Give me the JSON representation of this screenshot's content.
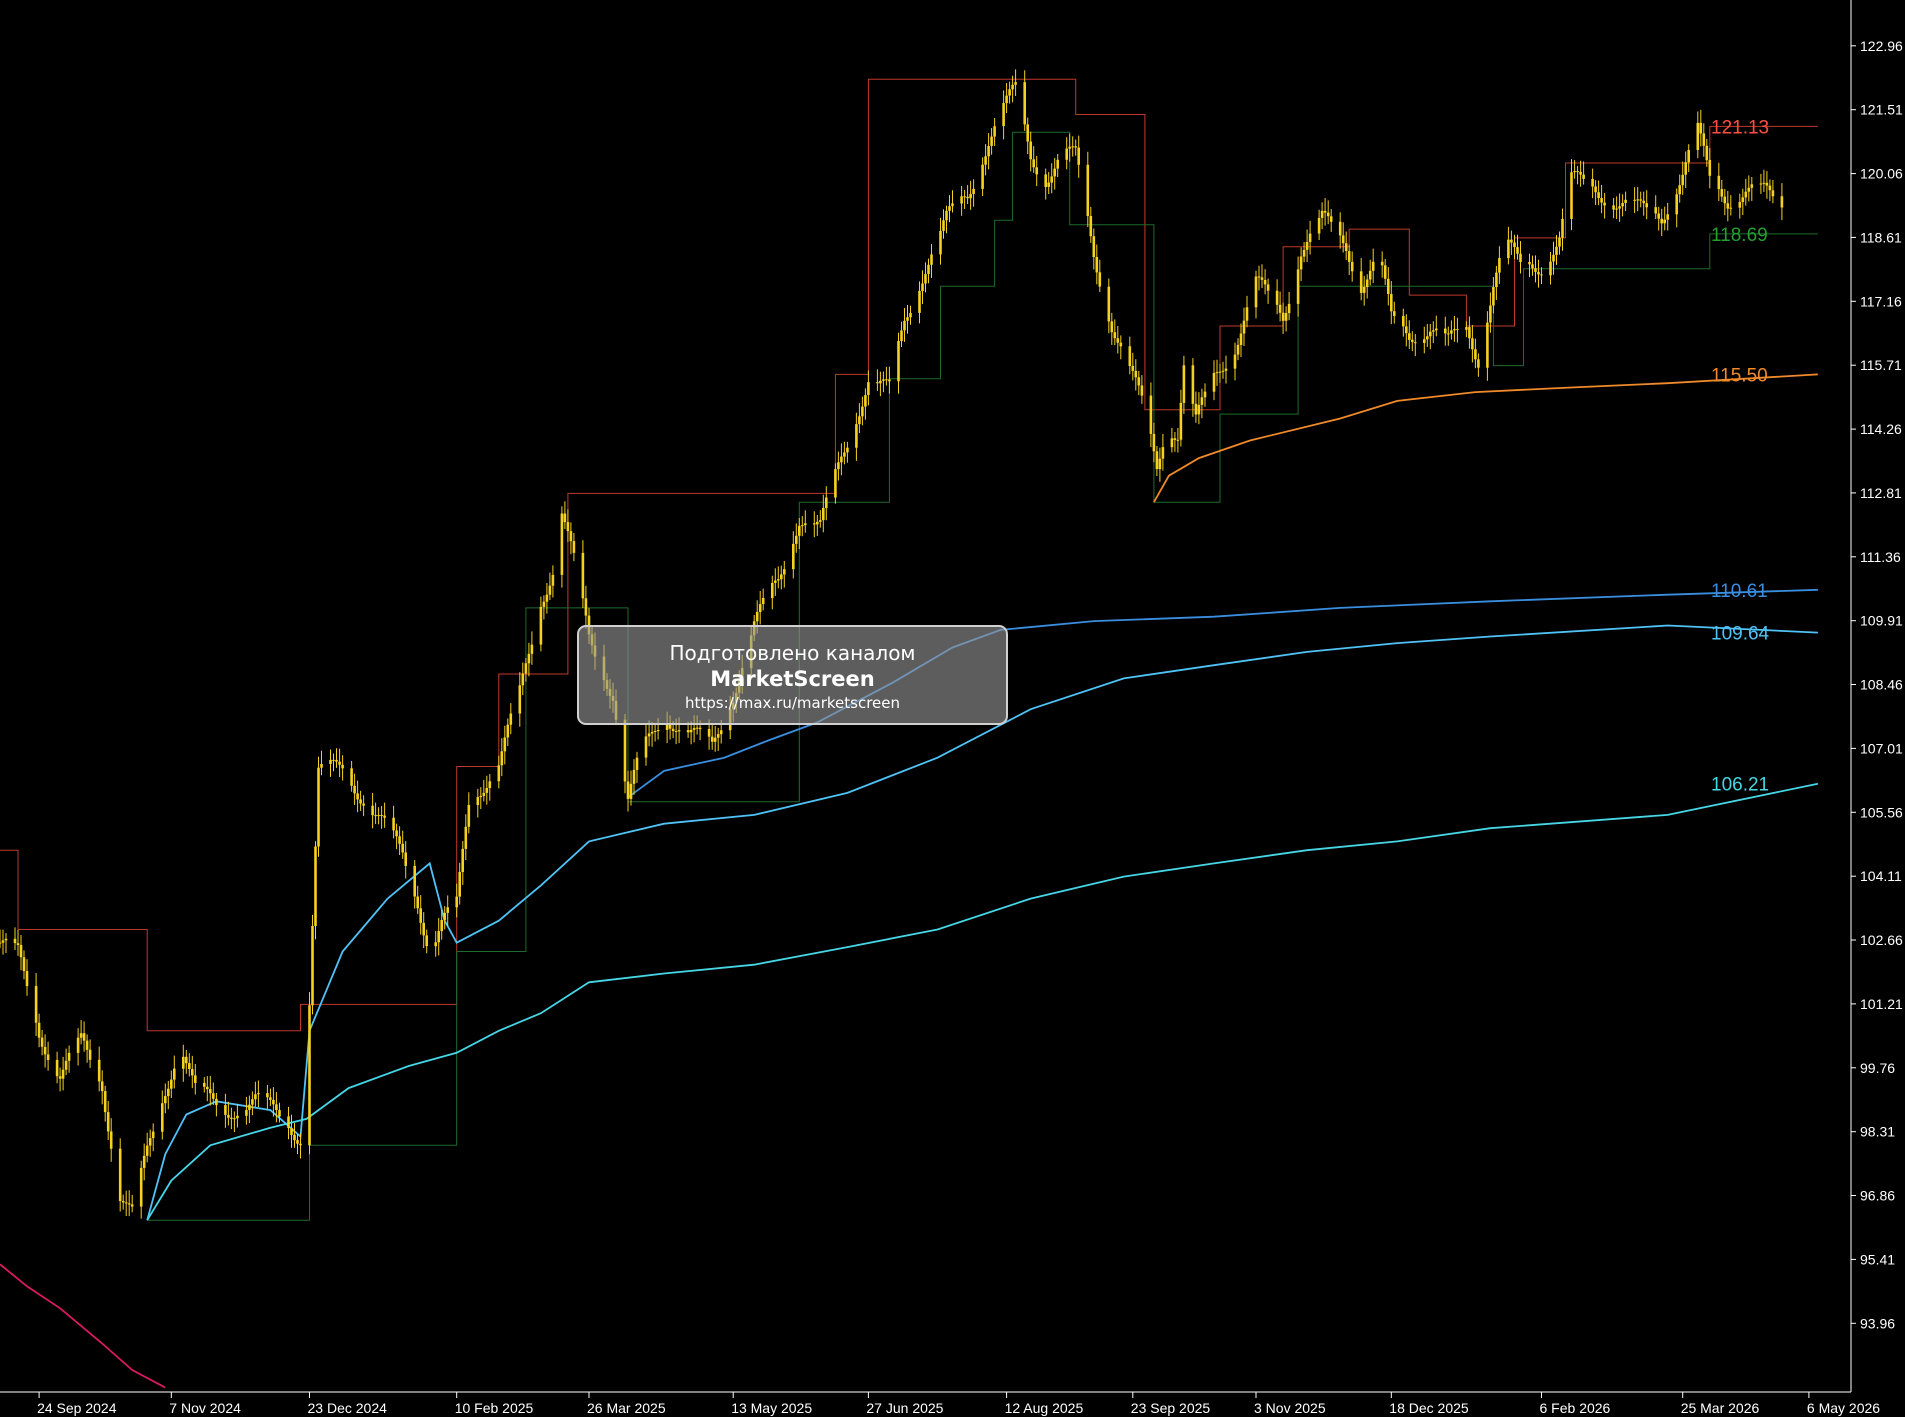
{
  "chart_data": {
    "type": "line",
    "subtype": "candlestick",
    "title": "",
    "y_axis": {
      "position": "right",
      "range": [
        92.4,
        124.0
      ],
      "ticks": [
        "122.96",
        "121.51",
        "120.06",
        "118.61",
        "117.16",
        "115.71",
        "114.26",
        "112.81",
        "111.36",
        "109.91",
        "108.46",
        "107.01",
        "105.56",
        "104.11",
        "102.66",
        "101.21",
        "99.76",
        "98.31",
        "96.86",
        "95.41",
        "93.96"
      ]
    },
    "x_axis": {
      "range": [
        "2024-09-11",
        "2026-05-20"
      ],
      "ticks": [
        {
          "date": "2024-09-24",
          "label": "24 Sep 2024"
        },
        {
          "date": "2024-11-07",
          "label": "7 Nov 2024"
        },
        {
          "date": "2024-12-23",
          "label": "23 Dec 2024"
        },
        {
          "date": "2025-02-10",
          "label": "10 Feb 2025"
        },
        {
          "date": "2025-03-26",
          "label": "26 Mar 2025"
        },
        {
          "date": "2025-05-13",
          "label": "13 May 2025"
        },
        {
          "date": "2025-06-27",
          "label": "27 Jun 2025"
        },
        {
          "date": "2025-08-12",
          "label": "12 Aug 2025"
        },
        {
          "date": "2025-09-23",
          "label": "23 Sep 2025"
        },
        {
          "date": "2025-11-03",
          "label": "3 Nov 2025"
        },
        {
          "date": "2025-12-18",
          "label": "18 Dec 2025"
        },
        {
          "date": "2026-02-06",
          "label": "6 Feb 2026"
        },
        {
          "date": "2026-03-25",
          "label": "25 Mar 2026"
        },
        {
          "date": "2026-05-06",
          "label": "6 May 2026"
        }
      ]
    },
    "grid": false,
    "colors": {
      "background": "#000000",
      "axis": "#ffffff",
      "candle": "#f5d21e",
      "upper_channel": "#c0392b",
      "lower_channel": "#1e6b2e",
      "vwap_orange": "#f08a2a",
      "vwap_blue": "#3a8ee0",
      "vwap_sky": "#4fc3f7",
      "vwap_cyan": "#46d6e6",
      "red_curve": "#d81b60"
    },
    "price_path": [
      [
        "2024-09-11",
        102.6
      ],
      [
        "2024-09-17",
        102.3
      ],
      [
        "2024-09-24",
        100.6
      ],
      [
        "2024-10-01",
        99.6
      ],
      [
        "2024-10-08",
        100.3
      ],
      [
        "2024-10-15",
        99.4
      ],
      [
        "2024-10-21",
        96.9
      ],
      [
        "2024-10-25",
        96.4
      ],
      [
        "2024-10-30",
        97.8
      ],
      [
        "2024-11-05",
        99.3
      ],
      [
        "2024-11-10",
        100.4
      ],
      [
        "2024-11-15",
        99.2
      ],
      [
        "2024-11-25",
        98.8
      ],
      [
        "2024-12-05",
        99.0
      ],
      [
        "2024-12-15",
        98.6
      ],
      [
        "2024-12-20",
        98.2
      ],
      [
        "2024-12-23",
        101.3
      ],
      [
        "2024-12-26",
        106.4
      ],
      [
        "2025-01-03",
        106.6
      ],
      [
        "2025-01-13",
        105.6
      ],
      [
        "2025-01-23",
        104.6
      ],
      [
        "2025-01-28",
        103.6
      ],
      [
        "2025-02-01",
        102.4
      ],
      [
        "2025-02-05",
        103.0
      ],
      [
        "2025-02-10",
        103.4
      ],
      [
        "2025-02-14",
        105.8
      ],
      [
        "2025-02-24",
        106.7
      ],
      [
        "2025-03-03",
        108.2
      ],
      [
        "2025-03-10",
        110.4
      ],
      [
        "2025-03-14",
        111.1
      ],
      [
        "2025-03-17",
        112.4
      ],
      [
        "2025-03-21",
        111.2
      ],
      [
        "2025-03-26",
        109.5
      ],
      [
        "2025-04-03",
        108.3
      ],
      [
        "2025-04-08",
        105.8
      ],
      [
        "2025-04-12",
        106.8
      ],
      [
        "2025-04-20",
        107.8
      ],
      [
        "2025-04-30",
        107.3
      ],
      [
        "2025-05-06",
        107.0
      ],
      [
        "2025-05-13",
        108.3
      ],
      [
        "2025-05-20",
        109.8
      ],
      [
        "2025-05-28",
        110.8
      ],
      [
        "2025-06-04",
        112.3
      ],
      [
        "2025-06-11",
        112.0
      ],
      [
        "2025-06-18",
        113.6
      ],
      [
        "2025-06-27",
        115.4
      ],
      [
        "2025-07-04",
        115.1
      ],
      [
        "2025-07-09",
        116.7
      ],
      [
        "2025-07-16",
        118.0
      ],
      [
        "2025-07-23",
        119.0
      ],
      [
        "2025-07-30",
        119.5
      ],
      [
        "2025-08-06",
        120.9
      ],
      [
        "2025-08-11",
        121.6
      ],
      [
        "2025-08-15",
        121.9
      ],
      [
        "2025-08-20",
        120.4
      ],
      [
        "2025-08-25",
        120.0
      ],
      [
        "2025-08-31",
        120.6
      ],
      [
        "2025-09-04",
        120.4
      ],
      [
        "2025-09-10",
        118.2
      ],
      [
        "2025-09-16",
        116.7
      ],
      [
        "2025-09-22",
        115.6
      ],
      [
        "2025-09-27",
        114.6
      ],
      [
        "2025-10-01",
        113.4
      ],
      [
        "2025-10-04",
        114.4
      ],
      [
        "2025-10-08",
        114.2
      ],
      [
        "2025-10-10",
        115.7
      ],
      [
        "2025-10-14",
        114.4
      ],
      [
        "2025-10-20",
        115.4
      ],
      [
        "2025-10-27",
        116.2
      ],
      [
        "2025-11-03",
        117.6
      ],
      [
        "2025-11-07",
        117.2
      ],
      [
        "2025-11-12",
        116.8
      ],
      [
        "2025-11-18",
        118.4
      ],
      [
        "2025-11-25",
        119.0
      ],
      [
        "2025-12-03",
        118.4
      ],
      [
        "2025-12-08",
        117.6
      ],
      [
        "2025-12-14",
        118.2
      ],
      [
        "2025-12-18",
        116.7
      ],
      [
        "2025-12-24",
        116.4
      ],
      [
        "2025-12-31",
        116.6
      ],
      [
        "2026-01-06",
        116.2
      ],
      [
        "2026-01-12",
        116.5
      ],
      [
        "2026-01-16",
        115.9
      ],
      [
        "2026-01-21",
        117.6
      ],
      [
        "2026-01-25",
        118.5
      ],
      [
        "2026-01-30",
        117.9
      ],
      [
        "2026-02-06",
        118.0
      ],
      [
        "2026-02-12",
        118.6
      ],
      [
        "2026-02-16",
        119.9
      ],
      [
        "2026-02-24",
        119.7
      ],
      [
        "2026-03-04",
        119.4
      ],
      [
        "2026-03-11",
        119.2
      ],
      [
        "2026-03-18",
        119.1
      ],
      [
        "2026-03-25",
        120.1
      ],
      [
        "2026-03-30",
        121.0
      ],
      [
        "2026-04-03",
        119.9
      ],
      [
        "2026-04-09",
        119.5
      ],
      [
        "2026-04-15",
        119.7
      ],
      [
        "2026-04-21",
        119.6
      ],
      [
        "2026-04-27",
        119.3
      ]
    ],
    "upper_channel": [
      [
        "2024-09-11",
        104.7
      ],
      [
        "2024-09-17",
        102.9
      ],
      [
        "2024-10-30",
        100.6
      ],
      [
        "2024-12-20",
        101.2
      ],
      [
        "2025-02-10",
        106.6
      ],
      [
        "2025-02-24",
        108.7
      ],
      [
        "2025-03-19",
        112.8
      ],
      [
        "2025-06-16",
        115.5
      ],
      [
        "2025-06-27",
        122.2
      ],
      [
        "2025-09-04",
        121.4
      ],
      [
        "2025-09-27",
        114.7
      ],
      [
        "2025-10-22",
        116.6
      ],
      [
        "2025-11-12",
        118.4
      ],
      [
        "2025-12-04",
        118.8
      ],
      [
        "2025-12-24",
        117.3
      ],
      [
        "2026-01-12",
        116.6
      ],
      [
        "2026-01-28",
        118.6
      ],
      [
        "2026-02-14",
        120.3
      ],
      [
        "2026-04-03",
        121.13
      ]
    ],
    "lower_channel": [
      [
        "2024-10-30",
        96.3
      ],
      [
        "2024-12-23",
        98.0
      ],
      [
        "2025-02-10",
        102.4
      ],
      [
        "2025-03-05",
        110.2
      ],
      [
        "2025-04-08",
        105.8
      ],
      [
        "2025-06-04",
        112.6
      ],
      [
        "2025-07-04",
        115.4
      ],
      [
        "2025-07-21",
        117.5
      ],
      [
        "2025-08-08",
        119.0
      ],
      [
        "2025-08-14",
        121.0
      ],
      [
        "2025-09-02",
        118.9
      ],
      [
        "2025-09-30",
        112.6
      ],
      [
        "2025-10-22",
        114.6
      ],
      [
        "2025-11-17",
        117.5
      ],
      [
        "2026-01-21",
        115.7
      ],
      [
        "2026-01-31",
        117.9
      ],
      [
        "2026-04-03",
        118.69
      ]
    ],
    "series": [
      {
        "values": [
          [
            "2025-09-30",
            112.6
          ],
          [
            "2025-10-05",
            113.2
          ],
          [
            "2025-10-15",
            113.6
          ],
          [
            "2025-11-01",
            114.0
          ],
          [
            "2025-12-01",
            114.5
          ],
          [
            "2025-12-20",
            114.9
          ],
          [
            "2026-01-15",
            115.1
          ],
          [
            "2026-02-15",
            115.2
          ],
          [
            "2026-03-20",
            115.3
          ],
          [
            "2026-05-09",
            115.5
          ]
        ]
      },
      {
        "values": [
          [
            "2025-04-08",
            105.9
          ],
          [
            "2025-04-20",
            106.5
          ],
          [
            "2025-05-10",
            106.8
          ],
          [
            "2025-05-25",
            107.2
          ],
          [
            "2025-06-10",
            107.6
          ],
          [
            "2025-07-05",
            108.5
          ],
          [
            "2025-07-25",
            109.3
          ],
          [
            "2025-08-10",
            109.7
          ],
          [
            "2025-09-10",
            109.9
          ],
          [
            "2025-10-20",
            110.0
          ],
          [
            "2025-12-01",
            110.2
          ],
          [
            "2026-01-20",
            110.35
          ],
          [
            "2026-03-20",
            110.5
          ],
          [
            "2026-05-09",
            110.61
          ]
        ]
      },
      {
        "values": [
          [
            "2024-10-30",
            96.3
          ],
          [
            "2024-11-05",
            97.8
          ],
          [
            "2024-11-12",
            98.7
          ],
          [
            "2024-11-22",
            99.0
          ],
          [
            "2024-12-10",
            98.8
          ],
          [
            "2024-12-20",
            98.2
          ],
          [
            "2024-12-23",
            100.6
          ],
          [
            "2025-01-03",
            102.4
          ],
          [
            "2025-01-18",
            103.6
          ],
          [
            "2025-02-01",
            104.4
          ],
          [
            "2025-02-06",
            103.1
          ],
          [
            "2025-02-10",
            102.6
          ],
          [
            "2025-02-24",
            103.1
          ],
          [
            "2025-03-10",
            103.9
          ],
          [
            "2025-03-26",
            104.9
          ],
          [
            "2025-04-20",
            105.3
          ],
          [
            "2025-05-20",
            105.5
          ],
          [
            "2025-06-20",
            106.0
          ],
          [
            "2025-07-20",
            106.8
          ],
          [
            "2025-08-20",
            107.9
          ],
          [
            "2025-09-20",
            108.6
          ],
          [
            "2025-10-20",
            108.9
          ],
          [
            "2025-11-20",
            109.2
          ],
          [
            "2025-12-20",
            109.4
          ],
          [
            "2026-01-20",
            109.55
          ],
          [
            "2026-03-20",
            109.8
          ],
          [
            "2026-05-09",
            109.64
          ]
        ]
      },
      {
        "values": [
          [
            "2024-10-30",
            96.3
          ],
          [
            "2024-11-07",
            97.2
          ],
          [
            "2024-11-20",
            98.0
          ],
          [
            "2024-12-10",
            98.4
          ],
          [
            "2024-12-22",
            98.6
          ],
          [
            "2025-01-05",
            99.3
          ],
          [
            "2025-01-25",
            99.8
          ],
          [
            "2025-02-10",
            100.1
          ],
          [
            "2025-02-24",
            100.6
          ],
          [
            "2025-03-10",
            101.0
          ],
          [
            "2025-03-26",
            101.7
          ],
          [
            "2025-04-20",
            101.9
          ],
          [
            "2025-05-20",
            102.1
          ],
          [
            "2025-06-20",
            102.5
          ],
          [
            "2025-07-20",
            102.9
          ],
          [
            "2025-08-20",
            103.6
          ],
          [
            "2025-09-20",
            104.1
          ],
          [
            "2025-10-20",
            104.4
          ],
          [
            "2025-11-20",
            104.7
          ],
          [
            "2025-12-20",
            104.9
          ],
          [
            "2026-01-20",
            105.2
          ],
          [
            "2026-03-20",
            105.5
          ],
          [
            "2026-05-09",
            106.21
          ]
        ]
      },
      {
        "values": [
          [
            "2024-09-11",
            95.3
          ],
          [
            "2024-09-20",
            94.8
          ],
          [
            "2024-10-01",
            94.3
          ],
          [
            "2024-10-15",
            93.5
          ],
          [
            "2024-10-25",
            92.9
          ],
          [
            "2024-11-05",
            92.5
          ]
        ]
      }
    ],
    "price_labels": [
      {
        "value": "121.13",
        "color": "#ff4f3f",
        "y": 121.13
      },
      {
        "value": "118.69",
        "color": "#24a031",
        "y": 118.69
      },
      {
        "value": "115.50",
        "color": "#f08a2a",
        "y": 115.5
      },
      {
        "value": "110.61",
        "color": "#3a8ee0",
        "y": 110.61
      },
      {
        "value": "109.64",
        "color": "#4fc3f7",
        "y": 109.64
      },
      {
        "value": "106.21",
        "color": "#46d6e6",
        "y": 106.21
      }
    ]
  },
  "watermark": {
    "line1": "Подготовлено каналом",
    "line2": "MarketScreen",
    "line3": "https://max.ru/marketscreen"
  }
}
